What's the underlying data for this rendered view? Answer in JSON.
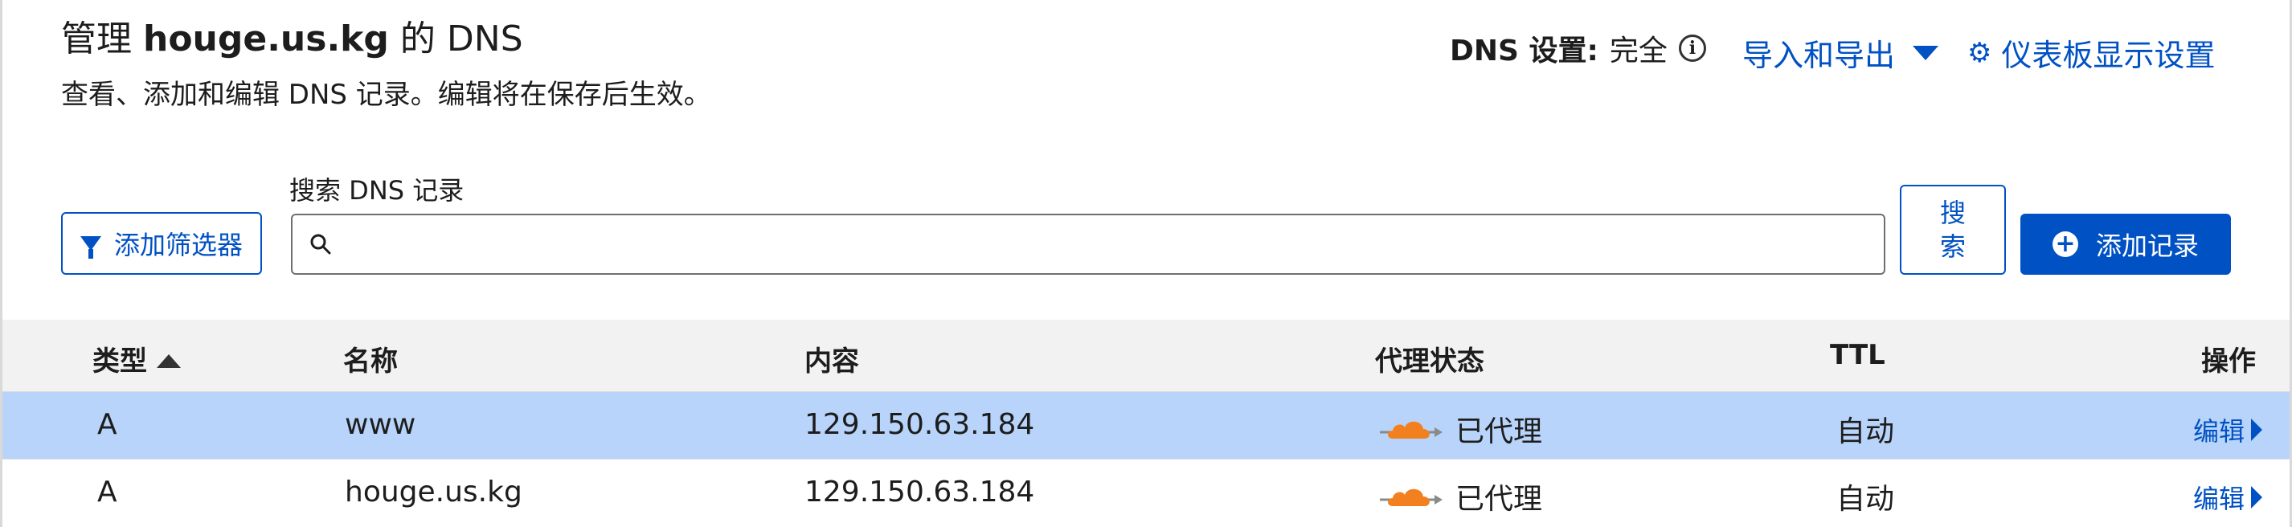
{
  "header": {
    "title_prefix": "管理 ",
    "title_domain": "houge.us.kg",
    "title_suffix": " 的 DNS",
    "subtitle": "查看、添加和编辑 DNS 记录。编辑将在保存后生效。"
  },
  "dns_settings": {
    "label": "DNS 设置:",
    "value": "完全",
    "info_icon": "info-circle-icon"
  },
  "toolbar": {
    "import_export": "导入和导出",
    "dashboard_settings": "仪表板显示设置",
    "filter_button": "添加筛选器",
    "search_label": "搜索 DNS 记录",
    "search_placeholder": "",
    "search_value": "",
    "search_button": "搜索",
    "add_record_button": "添加记录"
  },
  "table": {
    "columns": [
      "类型",
      "名称",
      "内容",
      "代理状态",
      "TTL",
      "操作"
    ],
    "sorted_column": "类型",
    "rows": [
      {
        "type": "A",
        "name": "www",
        "content": "129.150.63.184",
        "proxy": "已代理",
        "ttl": "自动",
        "action": "编辑",
        "selected": true
      },
      {
        "type": "A",
        "name": "houge.us.kg",
        "content": "129.150.63.184",
        "proxy": "已代理",
        "ttl": "自动",
        "action": "编辑",
        "selected": false
      }
    ]
  },
  "colors": {
    "link": "#0051c3",
    "selected_row": "#b8d4fa",
    "cloud": "#f38020",
    "header_bg": "#f2f2f2"
  }
}
